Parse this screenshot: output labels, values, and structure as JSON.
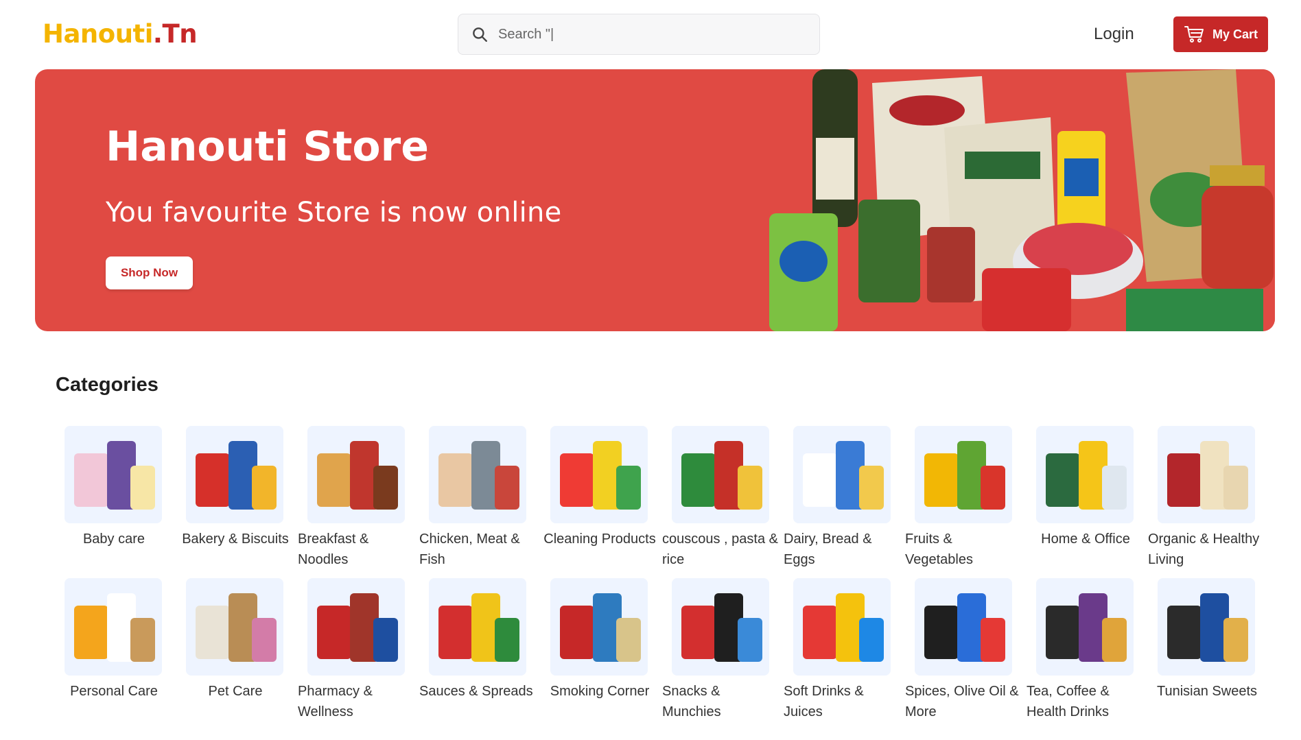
{
  "header": {
    "logo_part1": "Hanouti",
    "logo_part2": ".Tn",
    "search_placeholder": "Search \"|",
    "search_icon": "search-icon",
    "login_label": "Login",
    "cart_label": "My Cart",
    "cart_icon": "cart-icon"
  },
  "hero": {
    "title": "Hanouti Store",
    "subtitle": "You favourite Store is now online",
    "cta_label": "Shop Now"
  },
  "categories_title": "Categories",
  "categories": [
    {
      "label": "Baby care",
      "center": true
    },
    {
      "label": "Bakery & Biscuits",
      "center": true
    },
    {
      "label": "Breakfast & Noodles",
      "center": false
    },
    {
      "label": "Chicken, Meat & Fish",
      "center": false
    },
    {
      "label": "Cleaning Products",
      "center": true
    },
    {
      "label": "couscous , pasta & rice",
      "center": false
    },
    {
      "label": "Dairy, Bread & Eggs",
      "center": false
    },
    {
      "label": "Fruits & Vegetables",
      "center": false
    },
    {
      "label": "Home & Office",
      "center": true
    },
    {
      "label": "Organic & Healthy Living",
      "center": false
    },
    {
      "label": "Personal Care",
      "center": true
    },
    {
      "label": "Pet Care",
      "center": true
    },
    {
      "label": "Pharmacy & Wellness",
      "center": false
    },
    {
      "label": "Sauces & Spreads",
      "center": false
    },
    {
      "label": "Smoking Corner",
      "center": true
    },
    {
      "label": "Snacks & Munchies",
      "center": false
    },
    {
      "label": "Soft Drinks & Juices",
      "center": false
    },
    {
      "label": "Spices, Olive Oil & More",
      "center": false
    },
    {
      "label": "Tea, Coffee & Health Drinks",
      "center": false
    },
    {
      "label": "Tunisian Sweets",
      "center": true
    }
  ],
  "colors": {
    "brand_red": "#c62828",
    "brand_yellow": "#f4b400",
    "hero_bg": "#e04a43"
  }
}
